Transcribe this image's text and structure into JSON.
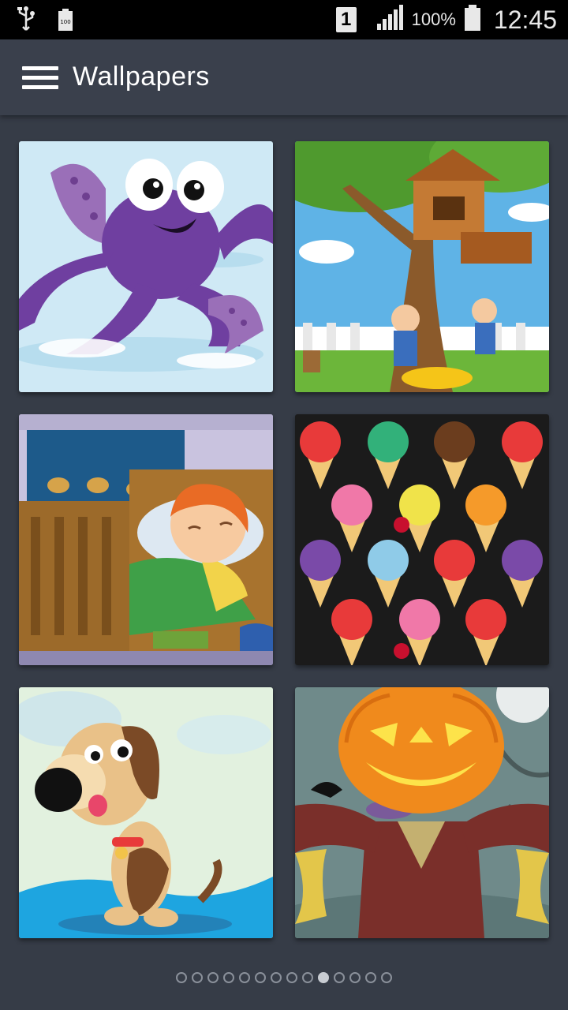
{
  "status_bar": {
    "usb_icon": "usb-icon",
    "battery_saver_icon": "battery-100-icon",
    "sim_label": "1",
    "signal_icon": "signal-icon",
    "battery_percent": "100%",
    "battery_icon": "battery-icon",
    "time": "12:45"
  },
  "app_bar": {
    "menu_icon": "hamburger-menu-icon",
    "title": "Wallpapers"
  },
  "wallpapers": [
    {
      "name": "purple-octopus"
    },
    {
      "name": "treehouse-kids"
    },
    {
      "name": "sleeping-boy"
    },
    {
      "name": "ice-cream-pattern"
    },
    {
      "name": "cartoon-dog"
    },
    {
      "name": "pumpkin-scarecrow"
    }
  ],
  "pager": {
    "page_count": 14,
    "active_page": 10
  },
  "colors": {
    "background": "#363c47",
    "app_bar": "#3a404c",
    "status_bar": "#000000"
  }
}
